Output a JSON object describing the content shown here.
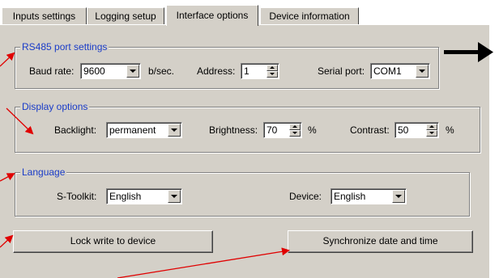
{
  "tabs": [
    {
      "label": "Inputs settings"
    },
    {
      "label": "Logging setup"
    },
    {
      "label": "Interface options"
    },
    {
      "label": "Device information"
    }
  ],
  "rs485": {
    "title": "RS485 port settings",
    "baud_label": "Baud rate:",
    "baud_value": "9600",
    "baud_unit": "b/sec.",
    "address_label": "Address:",
    "address_value": "1",
    "serial_label": "Serial port:",
    "serial_value": "COM1"
  },
  "display": {
    "title": "Display options",
    "backlight_label": "Backlight:",
    "backlight_value": "permanent",
    "brightness_label": "Brightness:",
    "brightness_value": "70",
    "brightness_unit": "%",
    "contrast_label": "Contrast:",
    "contrast_value": "50",
    "contrast_unit": "%"
  },
  "language": {
    "title": "Language",
    "toolkit_label": "S-Toolkit:",
    "toolkit_value": "English",
    "device_label": "Device:",
    "device_value": "English"
  },
  "buttons": {
    "lock_label": "Lock write to device",
    "sync_label": "Synchronize date and time"
  },
  "annotation_colors": {
    "pointer_arrows": "#e00000",
    "big_arrow": "#000000",
    "group_title": "#1a3cc8"
  }
}
